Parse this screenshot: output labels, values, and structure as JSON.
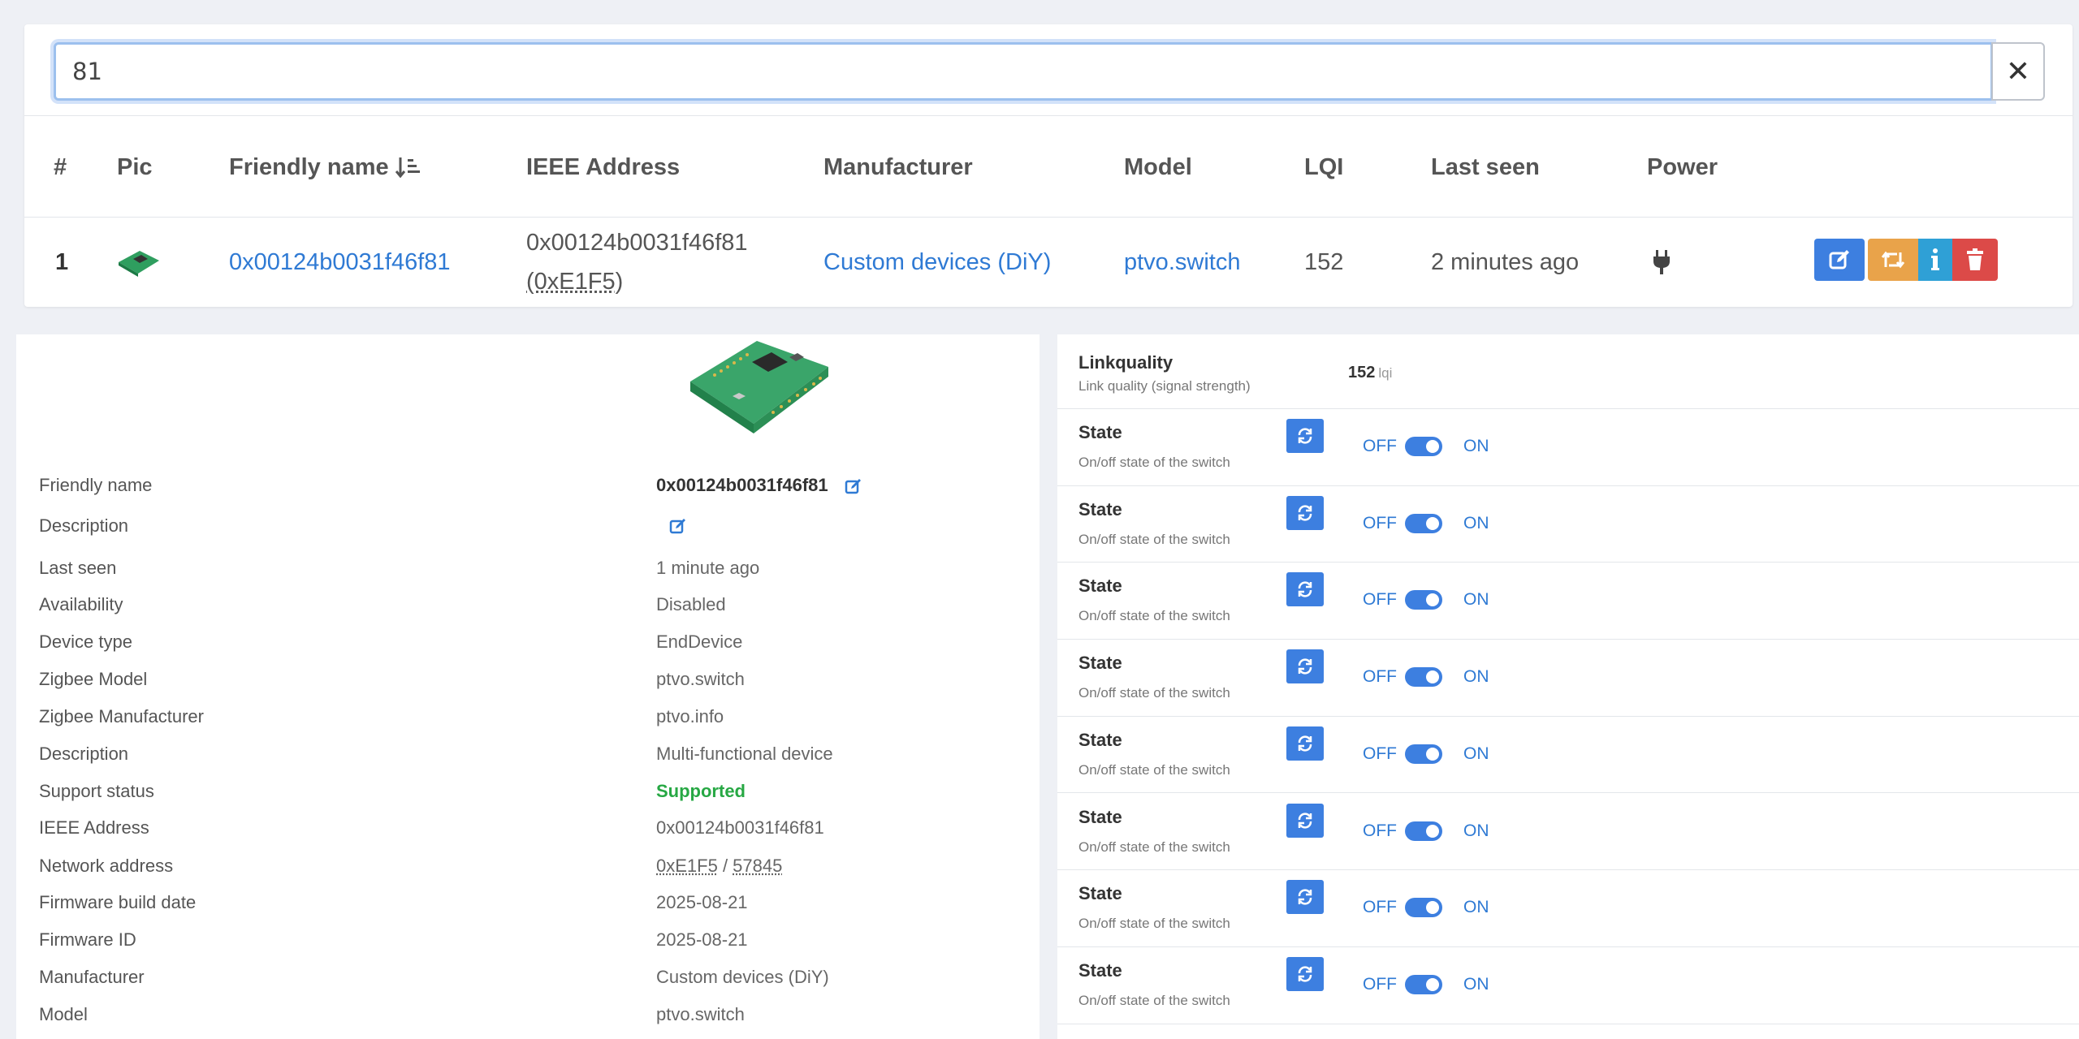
{
  "search": {
    "value": "81"
  },
  "table": {
    "headers": [
      "#",
      "Pic",
      "Friendly name",
      "IEEE Address",
      "Manufacturer",
      "Model",
      "LQI",
      "Last seen",
      "Power"
    ],
    "row": {
      "index": "1",
      "friendly_name": "0x00124b0031f46f81",
      "ieee_address": "0x00124b0031f46f81",
      "network_hex": "(0xE1F5)",
      "manufacturer": "Custom devices (DiY)",
      "model": "ptvo.switch",
      "lqi": "152",
      "last_seen": "2 minutes ago",
      "power_icon": "plug-icon"
    },
    "actions": [
      "edit-icon",
      "retweet-icon",
      "info-icon",
      "trash-icon"
    ]
  },
  "details": {
    "friendly_name": {
      "label": "Friendly name",
      "value": "0x00124b0031f46f81"
    },
    "description_edit": {
      "label": "Description"
    },
    "last_seen": {
      "label": "Last seen",
      "value": "1 minute ago"
    },
    "availability": {
      "label": "Availability",
      "value": "Disabled"
    },
    "device_type": {
      "label": "Device type",
      "value": "EndDevice"
    },
    "zigbee_model": {
      "label": "Zigbee Model",
      "value": "ptvo.switch"
    },
    "zigbee_manufacturer": {
      "label": "Zigbee Manufacturer",
      "value": "ptvo.info"
    },
    "description": {
      "label": "Description",
      "value": "Multi-functional device"
    },
    "support_status": {
      "label": "Support status",
      "value": "Supported"
    },
    "ieee_address": {
      "label": "IEEE Address",
      "value": "0x00124b0031f46f81"
    },
    "network_address": {
      "label": "Network address",
      "hex": "0xE1F5",
      "sep": " / ",
      "dec": "57845"
    },
    "firmware_build_date": {
      "label": "Firmware build date",
      "value": "2025-08-21"
    },
    "firmware_id": {
      "label": "Firmware ID",
      "value": "2025-08-21"
    },
    "manufacturer": {
      "label": "Manufacturer",
      "value": "Custom devices (DiY)"
    },
    "model": {
      "label": "Model",
      "value": "ptvo.switch"
    }
  },
  "exposes": {
    "linkquality": {
      "title": "Linkquality",
      "subtitle": "Link quality (signal strength)",
      "value": "152",
      "unit": "lqi"
    },
    "states": [
      {
        "title": "State",
        "subtitle": "On/off state of the switch",
        "off": "OFF",
        "on": "ON"
      },
      {
        "title": "State",
        "subtitle": "On/off state of the switch",
        "off": "OFF",
        "on": "ON"
      },
      {
        "title": "State",
        "subtitle": "On/off state of the switch",
        "off": "OFF",
        "on": "ON"
      },
      {
        "title": "State",
        "subtitle": "On/off state of the switch",
        "off": "OFF",
        "on": "ON"
      },
      {
        "title": "State",
        "subtitle": "On/off state of the switch",
        "off": "OFF",
        "on": "ON"
      },
      {
        "title": "State",
        "subtitle": "On/off state of the switch",
        "off": "OFF",
        "on": "ON"
      },
      {
        "title": "State",
        "subtitle": "On/off state of the switch",
        "off": "OFF",
        "on": "ON"
      },
      {
        "title": "State",
        "subtitle": "On/off state of the switch",
        "off": "OFF",
        "on": "ON"
      }
    ]
  },
  "colors": {
    "accent": "#3d7fe0",
    "link": "#2f7ad4",
    "success": "#27a844",
    "warning": "#e9a34a",
    "info": "#2fa0d6",
    "danger": "#dc4a48"
  }
}
